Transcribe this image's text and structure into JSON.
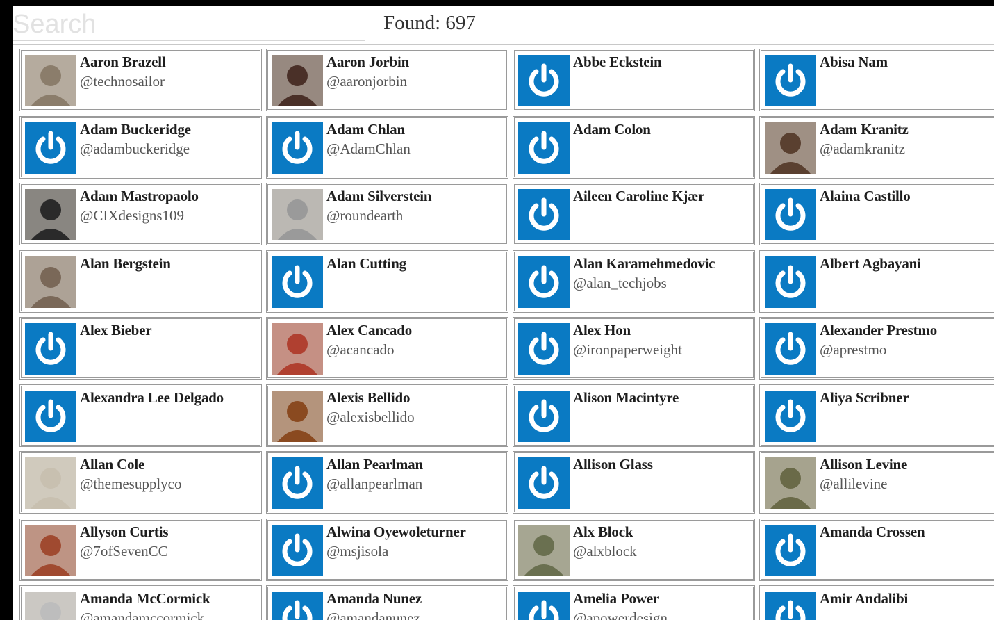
{
  "search": {
    "placeholder": "Search"
  },
  "found_text": "Found: 697",
  "colors": {
    "default_avatar": "#0a7ac3"
  },
  "people": [
    {
      "name": "Aaron Brazell",
      "handle": "@technosailor",
      "avatar": "photo",
      "tone": "#8b7d6b"
    },
    {
      "name": "Aaron Jorbin",
      "handle": "@aaronjorbin",
      "avatar": "photo",
      "tone": "#4a3028"
    },
    {
      "name": "Abbe Eckstein",
      "handle": "",
      "avatar": "default-power-icon"
    },
    {
      "name": "Abisa Nam",
      "handle": "",
      "avatar": "default-power-icon"
    },
    {
      "name": "Adam Buckeridge",
      "handle": "@adambuckeridge",
      "avatar": "default-power-icon"
    },
    {
      "name": "Adam Chlan",
      "handle": "@AdamChlan",
      "avatar": "default-power-icon"
    },
    {
      "name": "Adam Colon",
      "handle": "",
      "avatar": "default-power-icon"
    },
    {
      "name": "Adam Kranitz",
      "handle": "@adamkranitz",
      "avatar": "photo",
      "tone": "#5a4030"
    },
    {
      "name": "Adam Mastropaolo",
      "handle": "@CIXdesigns109",
      "avatar": "photo",
      "tone": "#2a2a2a"
    },
    {
      "name": "Adam Silverstein",
      "handle": "@roundearth",
      "avatar": "photo",
      "tone": "#9a9a9a"
    },
    {
      "name": "Aileen Caroline Kjær",
      "handle": "",
      "avatar": "default-power-icon"
    },
    {
      "name": "Alaina Castillo",
      "handle": "",
      "avatar": "default-power-icon"
    },
    {
      "name": "Alan Bergstein",
      "handle": "",
      "avatar": "photo",
      "tone": "#7a6858"
    },
    {
      "name": "Alan Cutting",
      "handle": "",
      "avatar": "default-power-icon"
    },
    {
      "name": "Alan Karamehmedovic",
      "handle": "@alan_techjobs",
      "avatar": "default-power-icon"
    },
    {
      "name": "Albert Agbayani",
      "handle": "",
      "avatar": "default-power-icon"
    },
    {
      "name": "Alex Bieber",
      "handle": "",
      "avatar": "default-power-icon"
    },
    {
      "name": "Alex Cancado",
      "handle": "@acancado",
      "avatar": "photo",
      "tone": "#b04030"
    },
    {
      "name": "Alex Hon",
      "handle": "@ironpaperweight",
      "avatar": "default-power-icon"
    },
    {
      "name": "Alexander Prestmo",
      "handle": "@aprestmo",
      "avatar": "default-power-icon"
    },
    {
      "name": "Alexandra Lee Delgado",
      "handle": "",
      "avatar": "default-power-icon"
    },
    {
      "name": "Alexis Bellido",
      "handle": "@alexisbellido",
      "avatar": "photo",
      "tone": "#8a4a20"
    },
    {
      "name": "Alison Macintyre",
      "handle": "",
      "avatar": "default-power-icon"
    },
    {
      "name": "Aliya Scribner",
      "handle": "",
      "avatar": "default-power-icon"
    },
    {
      "name": "Allan Cole",
      "handle": "@themesupplyco",
      "avatar": "photo",
      "tone": "#c8c0b0"
    },
    {
      "name": "Allan Pearlman",
      "handle": "@allanpearlman",
      "avatar": "default-power-icon"
    },
    {
      "name": "Allison Glass",
      "handle": "",
      "avatar": "default-power-icon"
    },
    {
      "name": "Allison Levine",
      "handle": "@allilevine",
      "avatar": "photo",
      "tone": "#6a6a48"
    },
    {
      "name": "Allyson Curtis",
      "handle": "@7ofSevenCC",
      "avatar": "photo",
      "tone": "#a04a30"
    },
    {
      "name": "Alwina Oyewoleturner",
      "handle": "@msjisola",
      "avatar": "default-power-icon"
    },
    {
      "name": "Alx Block",
      "handle": "@alxblock",
      "avatar": "photo",
      "tone": "#6a7050"
    },
    {
      "name": "Amanda Crossen",
      "handle": "",
      "avatar": "default-power-icon"
    },
    {
      "name": "Amanda McCormick",
      "handle": "@amandamccormick",
      "avatar": "photo",
      "tone": "#bdbdbd"
    },
    {
      "name": "Amanda Nunez",
      "handle": "@amandanunez",
      "avatar": "default-power-icon"
    },
    {
      "name": "Amelia Power",
      "handle": "@apowerdesign",
      "avatar": "default-power-icon"
    },
    {
      "name": "Amir Andalibi",
      "handle": "",
      "avatar": "default-power-icon"
    }
  ]
}
